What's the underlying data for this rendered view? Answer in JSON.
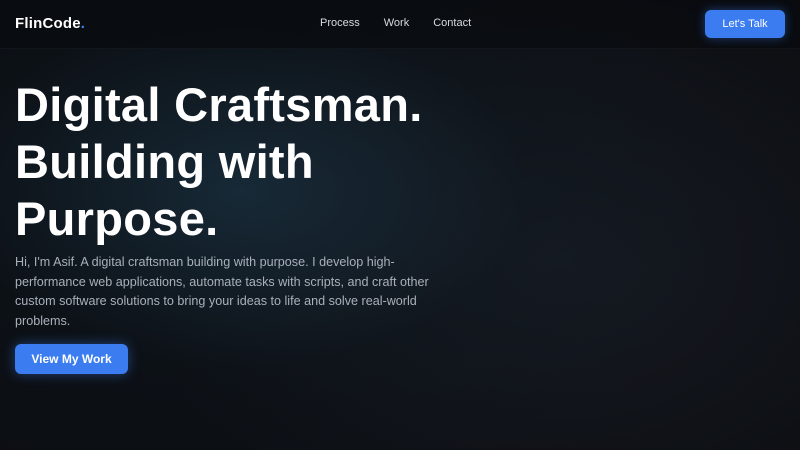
{
  "header": {
    "logo_text": "FlinCode",
    "logo_dot": ".",
    "nav": [
      "Process",
      "Work",
      "Contact"
    ],
    "cta_label": "Let's Talk"
  },
  "hero": {
    "title_lines": [
      "Digital Craftsman.",
      "Building with",
      "Purpose."
    ],
    "description": "Hi, I'm Asif. A digital craftsman building with purpose. I develop high-performance web applications, automate tasks with scripts, and craft other custom software solutions to bring your ideas to life and solve real-world problems.",
    "button_label": "View My Work"
  },
  "colors": {
    "accent": "#3b7cf1",
    "background": "#0c0e12",
    "muted_text": "#a9b0ba"
  }
}
